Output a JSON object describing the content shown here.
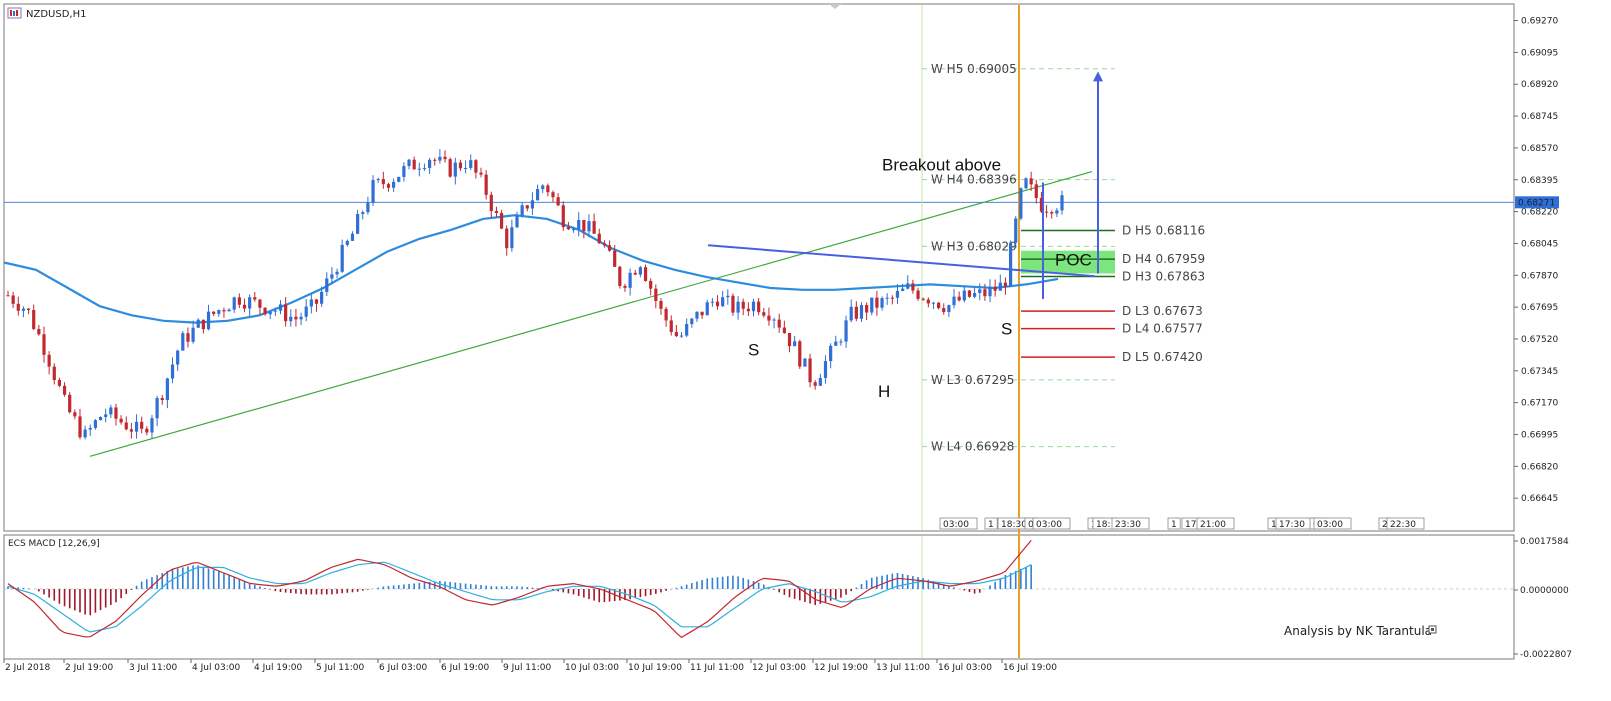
{
  "window": {
    "symbol_label": "NZDUSD,H1"
  },
  "indicator": {
    "macd_label": "ECS MACD [12,26,9]",
    "macd_top": "0.0017584",
    "macd_zero": "0.0000000",
    "macd_bottom": "-0.0022807"
  },
  "credit": "Analysis by NK Tarantula",
  "colors": {
    "bull": "#2f6fd6",
    "bear": "#c0292f",
    "ma": "#2b8ce0",
    "trend": "#3fa83f",
    "neckline": "#4a5fe0",
    "vline": "#e8a020",
    "poc": "#66e066",
    "macd_line": "#c0292f",
    "signal_line": "#2fb0e0"
  },
  "chart_data": {
    "type": "candlestick",
    "symbol": "NZDUSD",
    "timeframe": "H1",
    "ylim": [
      0.6647,
      0.6935
    ],
    "y_ticks": [
      "0.69270",
      "0.69095",
      "0.68920",
      "0.68745",
      "0.68570",
      "0.68395",
      "0.68220",
      "0.68045",
      "0.67870",
      "0.67695",
      "0.67520",
      "0.67345",
      "0.67170",
      "0.66995",
      "0.66820",
      "0.66645"
    ],
    "current_price": "0.68271",
    "x_labels": [
      "2 Jul 2018",
      "2 Jul 19:00",
      "3 Jul 11:00",
      "4 Jul 03:00",
      "4 Jul 19:00",
      "5 Jul 11:00",
      "6 Jul 03:00",
      "6 Jul 19:00",
      "9 Jul 11:00",
      "10 Jul 03:00",
      "10 Jul 19:00",
      "11 Jul 11:00",
      "12 Jul 03:00",
      "12 Jul 19:00",
      "13 Jul 11:00",
      "16 Jul 03:00",
      "16 Jul 19:00"
    ],
    "session_tags": [
      "03:00",
      "1",
      "18:30",
      "0",
      "03:00",
      "1",
      "18:",
      "23:30",
      "1",
      "17",
      "21:00",
      "1",
      "17:30",
      "0",
      "03:00",
      "2",
      "22:30"
    ],
    "close_path": [
      0.6776,
      0.6768,
      0.6745,
      0.6715,
      0.6698,
      0.6712,
      0.6706,
      0.67,
      0.6722,
      0.675,
      0.676,
      0.6768,
      0.6775,
      0.6771,
      0.6768,
      0.6763,
      0.677,
      0.679,
      0.681,
      0.6835,
      0.684,
      0.6847,
      0.6852,
      0.6845,
      0.685,
      0.6832,
      0.6805,
      0.6825,
      0.6838,
      0.6818,
      0.6815,
      0.6805,
      0.6782,
      0.6795,
      0.6768,
      0.6752,
      0.6765,
      0.6775,
      0.6768,
      0.6772,
      0.6765,
      0.6748,
      0.6728,
      0.6745,
      0.6765,
      0.677,
      0.6773,
      0.678,
      0.6775,
      0.677,
      0.6775,
      0.6777,
      0.6782,
      0.6839,
      0.6825,
      0.6827
    ],
    "moving_average_path": [
      0.6794,
      0.679,
      0.678,
      0.677,
      0.6765,
      0.6762,
      0.6761,
      0.6762,
      0.6765,
      0.6772,
      0.678,
      0.679,
      0.68,
      0.6807,
      0.6812,
      0.6818,
      0.682,
      0.6818,
      0.6812,
      0.6802,
      0.6795,
      0.679,
      0.6786,
      0.6783,
      0.678,
      0.6779,
      0.6779,
      0.678,
      0.6781,
      0.6782,
      0.6781,
      0.678,
      0.6782,
      0.6785
    ],
    "weekly_pivots": [
      {
        "label": "W  H5 0.69005",
        "value": 0.69005
      },
      {
        "label": "W  H4 0.68396",
        "value": 0.68396
      },
      {
        "label": "W  H3 0.68029",
        "value": 0.68029
      },
      {
        "label": "W  L3 0.67295",
        "value": 0.67295
      },
      {
        "label": "W  L4 0.66928",
        "value": 0.66928
      }
    ],
    "daily_pivots": [
      {
        "label": "D  H5 0.68116",
        "value": 0.68116,
        "color": "#1e6e1e"
      },
      {
        "label": "D  H4 0.67959",
        "value": 0.67959,
        "color": "#1e6e1e"
      },
      {
        "label": "D  H3 0.67863",
        "value": 0.67863,
        "color": "#1e6e1e"
      },
      {
        "label": "D  L3 0.67673",
        "value": 0.67673,
        "color": "#d02020"
      },
      {
        "label": "D  L4 0.67577",
        "value": 0.67577,
        "color": "#d02020"
      },
      {
        "label": "D  L5 0.67420",
        "value": 0.6742,
        "color": "#d02020"
      }
    ],
    "annotations": {
      "breakout": "Breakout above",
      "poc": "POC",
      "pattern": [
        "S",
        "H",
        "S"
      ]
    },
    "macd_hist_path": [
      0.0001,
      0.0,
      -0.0006,
      -0.001,
      -0.0005,
      0.0003,
      0.0007,
      0.0009,
      0.0006,
      0.0002,
      -0.0001,
      -0.0002,
      -0.0002,
      -0.0001,
      0.0001,
      0.0002,
      0.0003,
      0.0002,
      0.0001,
      0.0001,
      0.0,
      -0.0002,
      -0.0005,
      -0.0004,
      -0.0002,
      0.0001,
      0.0004,
      0.0005,
      0.0002,
      -0.0003,
      -0.0006,
      -0.0003,
      0.0004,
      0.0006,
      0.0004,
      0.0001,
      -0.0002,
      0.0005,
      0.0009
    ],
    "macd_line_path": [
      0.0002,
      -0.0005,
      -0.0016,
      -0.0018,
      -0.0012,
      -0.0002,
      0.0007,
      0.001,
      0.0006,
      0.0002,
      0.0001,
      0.0003,
      0.0008,
      0.0011,
      0.0009,
      0.0004,
      0.0001,
      -0.0004,
      -0.0006,
      -0.0003,
      0.0001,
      0.0002,
      0.0,
      -0.0004,
      -0.0008,
      -0.0018,
      -0.0012,
      -0.0003,
      0.0004,
      0.0003,
      -0.0004,
      -0.0007,
      0.0,
      0.0004,
      0.0003,
      0.0001,
      0.0003,
      0.0006,
      0.0018
    ],
    "signal_line_path": [
      0.0001,
      -0.0002,
      -0.0009,
      -0.0016,
      -0.0014,
      -0.0006,
      0.0003,
      0.0008,
      0.0008,
      0.0004,
      0.0002,
      0.0002,
      0.0006,
      0.0009,
      0.001,
      0.0006,
      0.0002,
      -0.0001,
      -0.0004,
      -0.0004,
      -0.0001,
      0.0001,
      0.0001,
      -0.0002,
      -0.0006,
      -0.0014,
      -0.0014,
      -0.0007,
      0.0,
      0.0002,
      -0.0001,
      -0.0005,
      -0.0003,
      0.0001,
      0.0003,
      0.0002,
      0.0002,
      0.0004,
      0.0009
    ]
  }
}
